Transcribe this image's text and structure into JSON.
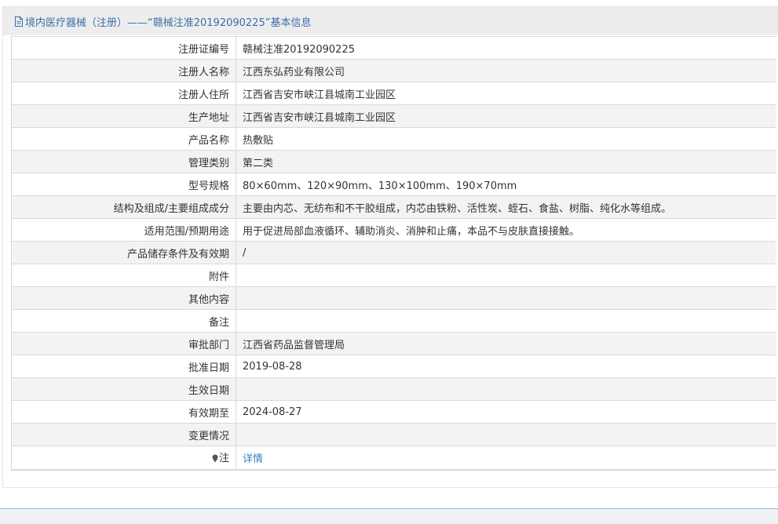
{
  "header": {
    "title": "境内医疗器械（注册）——“赣械注准20192090225”基本信息",
    "icon": "document-icon"
  },
  "rows": [
    {
      "label": "注册证编号",
      "value": "赣械注准20192090225"
    },
    {
      "label": "注册人名称",
      "value": "江西东弘药业有限公司"
    },
    {
      "label": "注册人住所",
      "value": "江西省吉安市峡江县城南工业园区"
    },
    {
      "label": "生产地址",
      "value": "江西省吉安市峡江县城南工业园区"
    },
    {
      "label": "产品名称",
      "value": "热敷贴"
    },
    {
      "label": "管理类别",
      "value": "第二类"
    },
    {
      "label": "型号规格",
      "value": "80×60mm、120×90mm、130×100mm、190×70mm"
    },
    {
      "label": "结构及组成/主要组成成分",
      "value": "主要由内芯、无纺布和不干胶组成，内芯由铁粉、活性炭、蛭石、食盐、树脂、纯化水等组成。"
    },
    {
      "label": "适用范围/预期用途",
      "value": "用于促进局部血液循环、辅助消炎、消肿和止痛，本品不与皮肤直接接触。"
    },
    {
      "label": "产品储存条件及有效期",
      "value": "/"
    },
    {
      "label": "附件",
      "value": ""
    },
    {
      "label": "其他内容",
      "value": ""
    },
    {
      "label": "备注",
      "value": ""
    },
    {
      "label": "审批部门",
      "value": "江西省药品监督管理局"
    },
    {
      "label": "批准日期",
      "value": "2019-08-28"
    },
    {
      "label": "生效日期",
      "value": ""
    },
    {
      "label": "有效期至",
      "value": "2024-08-27"
    },
    {
      "label": "变更情况",
      "value": ""
    }
  ],
  "note_row": {
    "label": "注",
    "link_text": "详情",
    "icon": "pin-icon"
  },
  "colors": {
    "header_text": "#3a6fa8",
    "link": "#3a7cc2",
    "stripe": "#f3f3f3",
    "border": "#d9d9d9"
  }
}
